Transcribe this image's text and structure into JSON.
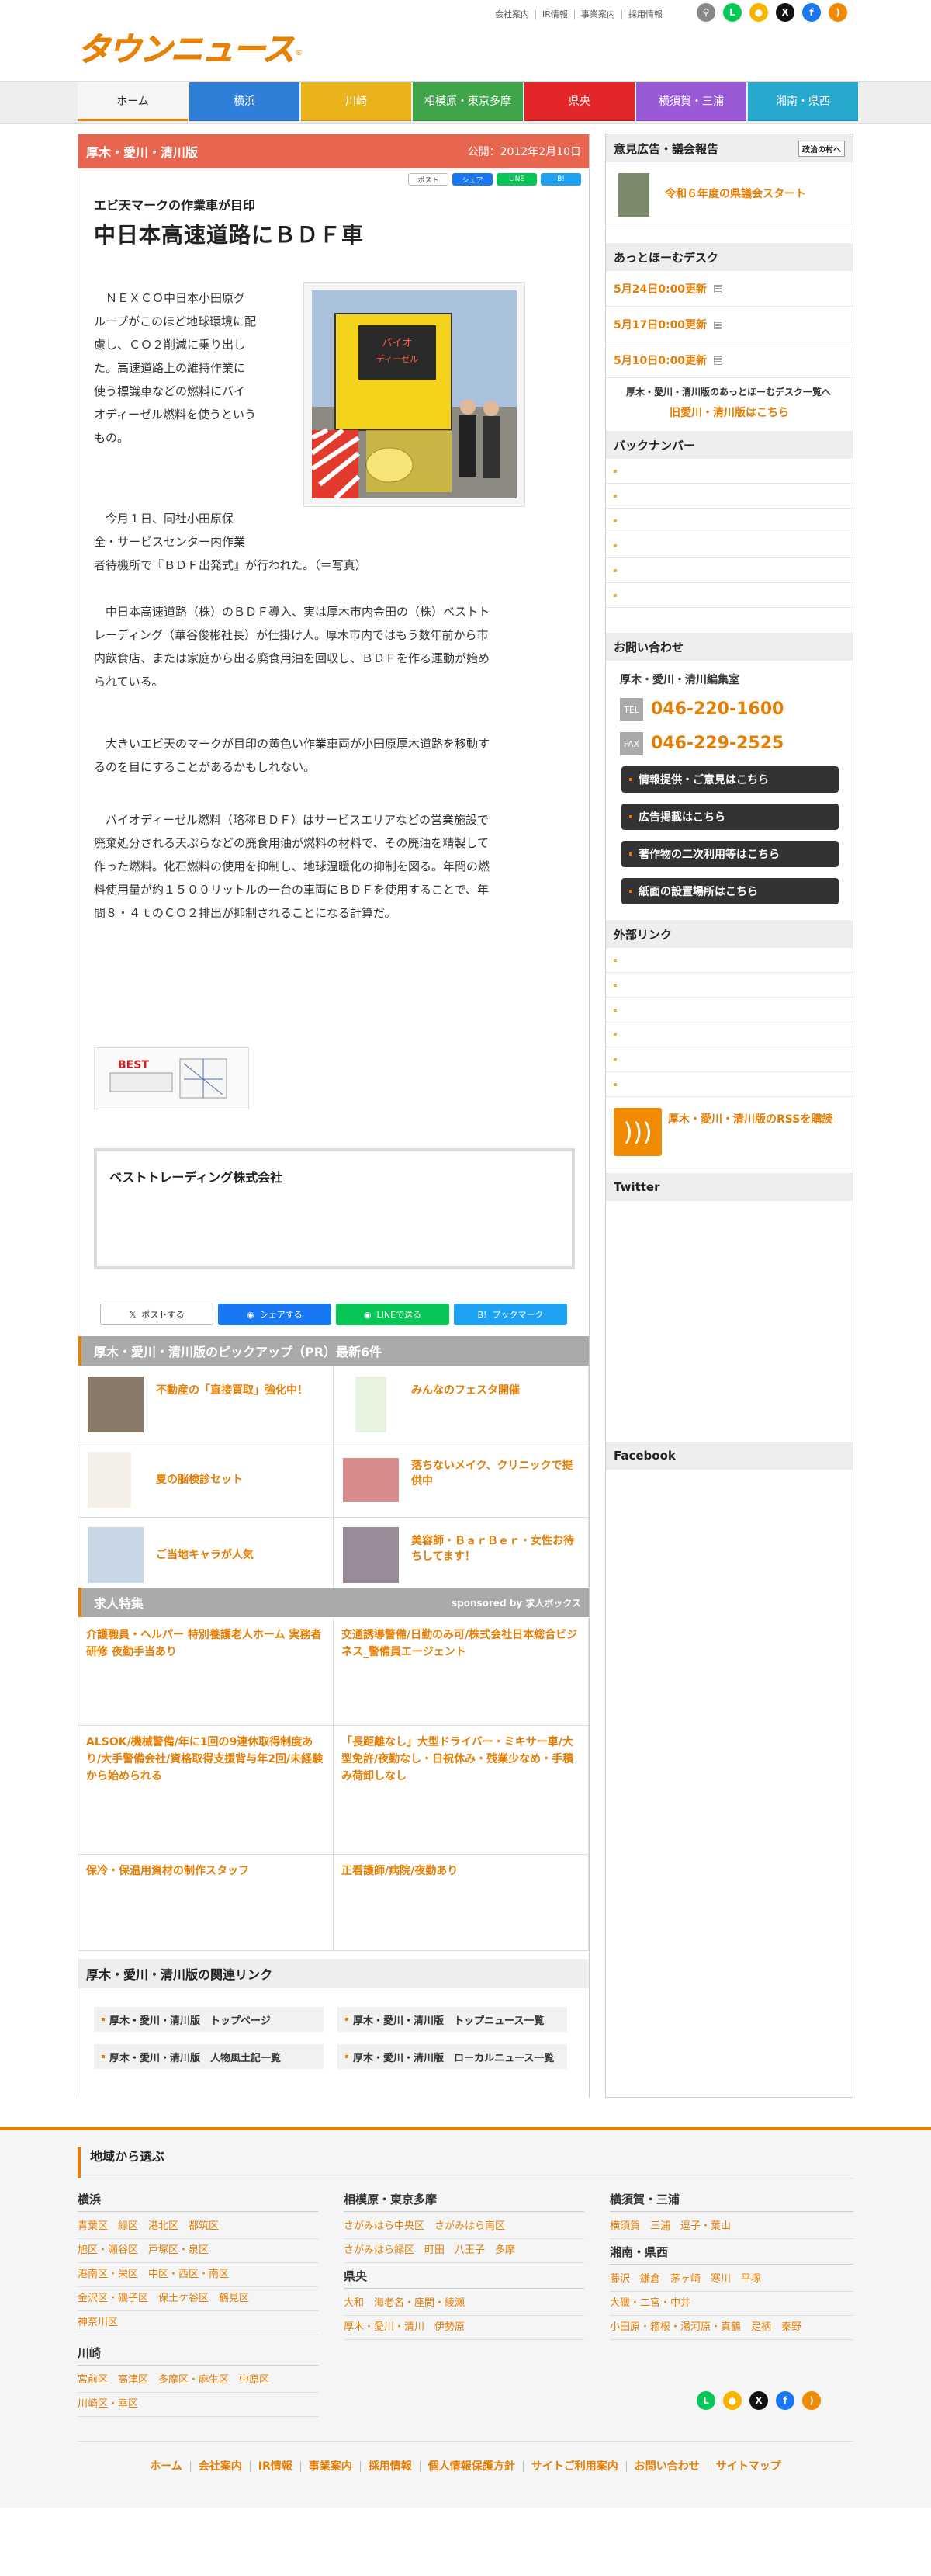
{
  "header": {
    "logo_text": "タウンニュース",
    "logo_reg": "®",
    "toplinks": [
      "会社案内",
      "IR情報",
      "事業案内",
      "採用情報"
    ]
  },
  "nav": [
    {
      "label": "ホーム",
      "color": "#f5f5f5"
    },
    {
      "label": "横浜",
      "color": "#2f7fd8"
    },
    {
      "label": "川崎",
      "color": "#e9b21b"
    },
    {
      "label": "相模原・東京多摩",
      "color": "#3fa44a"
    },
    {
      "label": "県央",
      "color": "#e3262a"
    },
    {
      "label": "横須賀・三浦",
      "color": "#9a5ad6"
    },
    {
      "label": "湘南・県西",
      "color": "#27a8cf"
    }
  ],
  "article": {
    "region": "厚木・愛川・清川版",
    "published": "公開：2012年2月10日",
    "share_top": [
      "ポスト",
      "シェア",
      "LINE",
      "B!"
    ],
    "subtitle": "エビ天マークの作業車が目印",
    "title": "中日本高速道路にＢＤＦ車",
    "p1": [
      "　ＮＥＸＣＯ中日本小田原グ",
      "ループがこのほど地球環境に配",
      "慮し、ＣＯ２削減に乗り出し",
      "た。高速道路上の維持作業に",
      "使う標識車などの燃料にバイ",
      "オディーゼル燃料を使うという",
      "もの。"
    ],
    "p2": [
      "　今月１日、同社小田原保",
      "全・サービスセンター内作業",
      "者待機所で『ＢＤＦ出発式』が行われた。（＝写真）"
    ],
    "p3": [
      "　中日本高速道路（株）のＢＤＦ導入、実は厚木市内金田の（株）ベストト",
      "レーディング（華谷俊彬社長）が仕掛け人。厚木市内ではもう数年前から市",
      "内飲食店、または家庭から出る廃食用油を回収し、ＢＤＦを作る運動が始め",
      "られている。"
    ],
    "p4": [
      "　大きいエビ天のマークが目印の黄色い作業車両が小田原厚木道路を移動す",
      "るのを目にすることがあるかもしれない。"
    ],
    "p5": [
      "　バイオディーゼル燃料（略称ＢＤＦ）はサービスエリアなどの営業施設で",
      "廃棄処分される天ぷらなどの廃食用油が燃料の材料で、その廃油を精製して",
      "作った燃料。化石燃料の使用を抑制し、地球温暖化の抑制を図る。年間の燃",
      "料使用量が約１５００リットルの一台の車両にＢＤＦを使用することで、年",
      "間８・４ｔのＣＯ２排出が抑制されることになる計算だ。"
    ],
    "photo_sign": "バイオディーゼル",
    "company": "ベストトレーディング株式会社",
    "share_bottom": [
      "ポストする",
      "シェアする",
      "LINEで送る",
      "ブックマーク"
    ]
  },
  "pickup": {
    "head": "厚木・愛川・清川版のピックアップ（PR）最新6件",
    "items": [
      "不動産の「直接買取」強化中！",
      "みんなのフェスタ開催",
      "夏の脳検診セット",
      "落ちないメイク、クリニックで提供中",
      "ご当地キャラが人気",
      "美容師・ＢａｒＢｅｒ・女性お待ちしてます！"
    ]
  },
  "jobs": {
    "head": "求人特集",
    "sponsor": "sponsored by 求人ボックス",
    "items": [
      "介護職員・ヘルパー 特別養護老人ホーム 実務者研修 夜勤手当あり",
      "交通誘導警備/日勤のみ可/株式会社日本総合ビジネス_警備員エージェント",
      "ALSOK/機械警備/年に1回の9連休取得制度あり/大手警備会社/資格取得支援背与年2回/未経験から始められる",
      "「長距離なし」大型ドライバー・ミキサー車/大型免許/夜勤なし・日祝休み・残業少なめ・手積み荷卸しなし",
      "保冷・保温用資材の制作スタッフ",
      "正看護師/病院/夜勤あり"
    ]
  },
  "related": {
    "head": "厚木・愛川・清川版の関連リンク",
    "links": [
      "厚木・愛川・清川版　トップページ",
      "厚木・愛川・清川版　トップニュース一覧",
      "厚木・愛川・清川版　人物風土記一覧",
      "厚木・愛川・清川版　ローカルニュース一覧"
    ]
  },
  "sidebar": {
    "opinion_head": "意見広告・議会報告",
    "opinion_badge": "政治の村へ",
    "opinion_item": "令和６年度の県議会スタート",
    "athome_head": "あっとほーむデスク",
    "athome_items": [
      "5月24日0:00更新",
      "5月17日0:00更新",
      "5月10日0:00更新"
    ],
    "athome_list": "厚木・愛川・清川版のあっとほーむデスク一覧へ",
    "athome_old": "旧愛川・清川版はこちら",
    "backnumber_head": "バックナンバー",
    "contact_head": "お問い合わせ",
    "contact_office": "厚木・愛川・清川編集室",
    "tel_label": "TEL",
    "tel": "046-220-1600",
    "fax_label": "FAX",
    "fax": "046-229-2525",
    "buttons": [
      "情報提供・ご意見はこちら",
      "広告掲載はこちら",
      "著作物の二次利用等はこちら",
      "紙面の設置場所はこちら"
    ],
    "external_head": "外部リンク",
    "rss": "厚木・愛川・清川版のRSSを購読",
    "twitter_head": "Twitter",
    "facebook_head": "Facebook"
  },
  "footer": {
    "head": "地域から選ぶ",
    "yokohama_head": "横浜",
    "yokohama": [
      "青葉区　緑区　港北区　都筑区",
      "旭区・瀬谷区　戸塚区・泉区",
      "港南区・栄区　中区・西区・南区",
      "金沢区・磯子区　保土ケ谷区　鶴見区",
      "神奈川区"
    ],
    "kawasaki_head": "川崎",
    "kawasaki": [
      "宮前区　高津区　多摩区・麻生区　中原区",
      "川崎区・幸区"
    ],
    "sagamihara_head": "相模原・東京多摩",
    "sagamihara": [
      "さがみはら中央区　さがみはら南区",
      "さがみはら緑区　町田　八王子　多摩"
    ],
    "kenou_head": "県央",
    "kenou": [
      "大和　海老名・座間・綾瀬",
      "厚木・愛川・清川　伊勢原"
    ],
    "yokosuka_head": "横須賀・三浦",
    "yokosuka": [
      "横須賀　三浦　逗子・葉山"
    ],
    "shonan_head": "湘南・県西",
    "shonan": [
      "藤沢　鎌倉　茅ヶ崎　寒川　平塚",
      "大磯・二宮・中井",
      "小田原・箱根・湯河原・真鶴　足柄　秦野"
    ],
    "nav": [
      "ホーム",
      "会社案内",
      "IR情報",
      "事業案内",
      "採用情報",
      "個人情報保護方針",
      "サイトご利用案内",
      "お問い合わせ",
      "サイトマップ"
    ]
  }
}
